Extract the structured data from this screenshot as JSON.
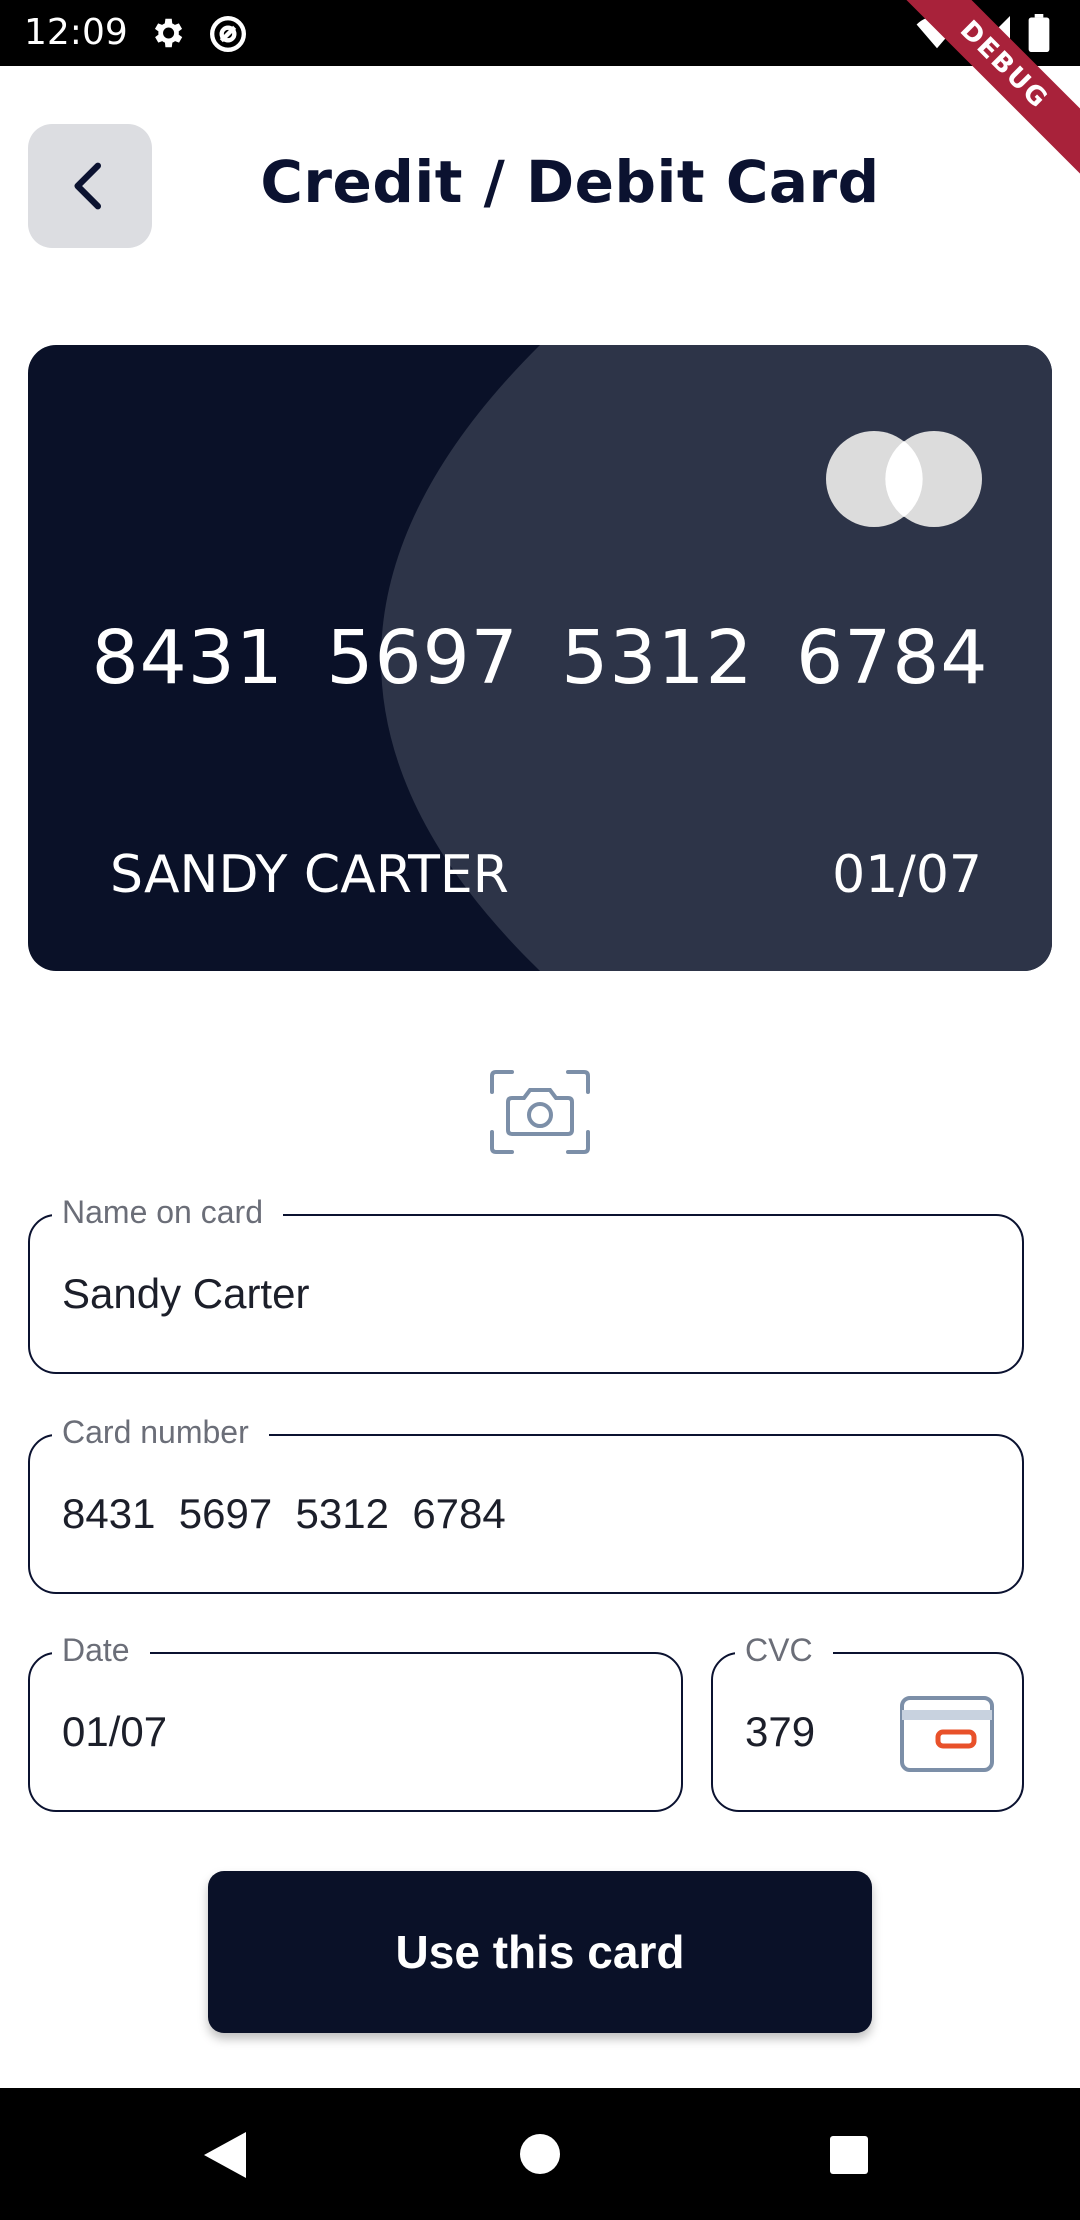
{
  "status_bar": {
    "time": "12:09",
    "icons": [
      "gear-icon",
      "at-sign-icon",
      "wifi-icon",
      "signal-icon",
      "battery-icon"
    ],
    "debug_banner": "DEBUG"
  },
  "header": {
    "back_icon": "chevron-left-icon",
    "title": "Credit / Debit Card"
  },
  "card": {
    "brand_icon": "mastercard-logo-icon",
    "number": "8431 5697 5312 6784",
    "holder": "SANDY CARTER",
    "expiry": "01/07",
    "colors": {
      "base": "#0a1128",
      "overlay": "#2d3448"
    }
  },
  "scan": {
    "icon": "camera-scan-icon"
  },
  "form": {
    "name": {
      "label": "Name on card",
      "value": "Sandy Carter"
    },
    "number": {
      "label": "Card number",
      "value": "8431  5697  5312  6784"
    },
    "date": {
      "label": "Date",
      "value": "01/07"
    },
    "cvc": {
      "label": "CVC",
      "value": "379",
      "icon": "card-back-icon"
    }
  },
  "actions": {
    "use_card_label": "Use this card"
  },
  "nav": {
    "icons": [
      "nav-back-icon",
      "nav-home-icon",
      "nav-recents-icon"
    ]
  },
  "theme": {
    "primary": "#0a1128",
    "accent": "#e8512a",
    "debug": "#a8223a"
  }
}
